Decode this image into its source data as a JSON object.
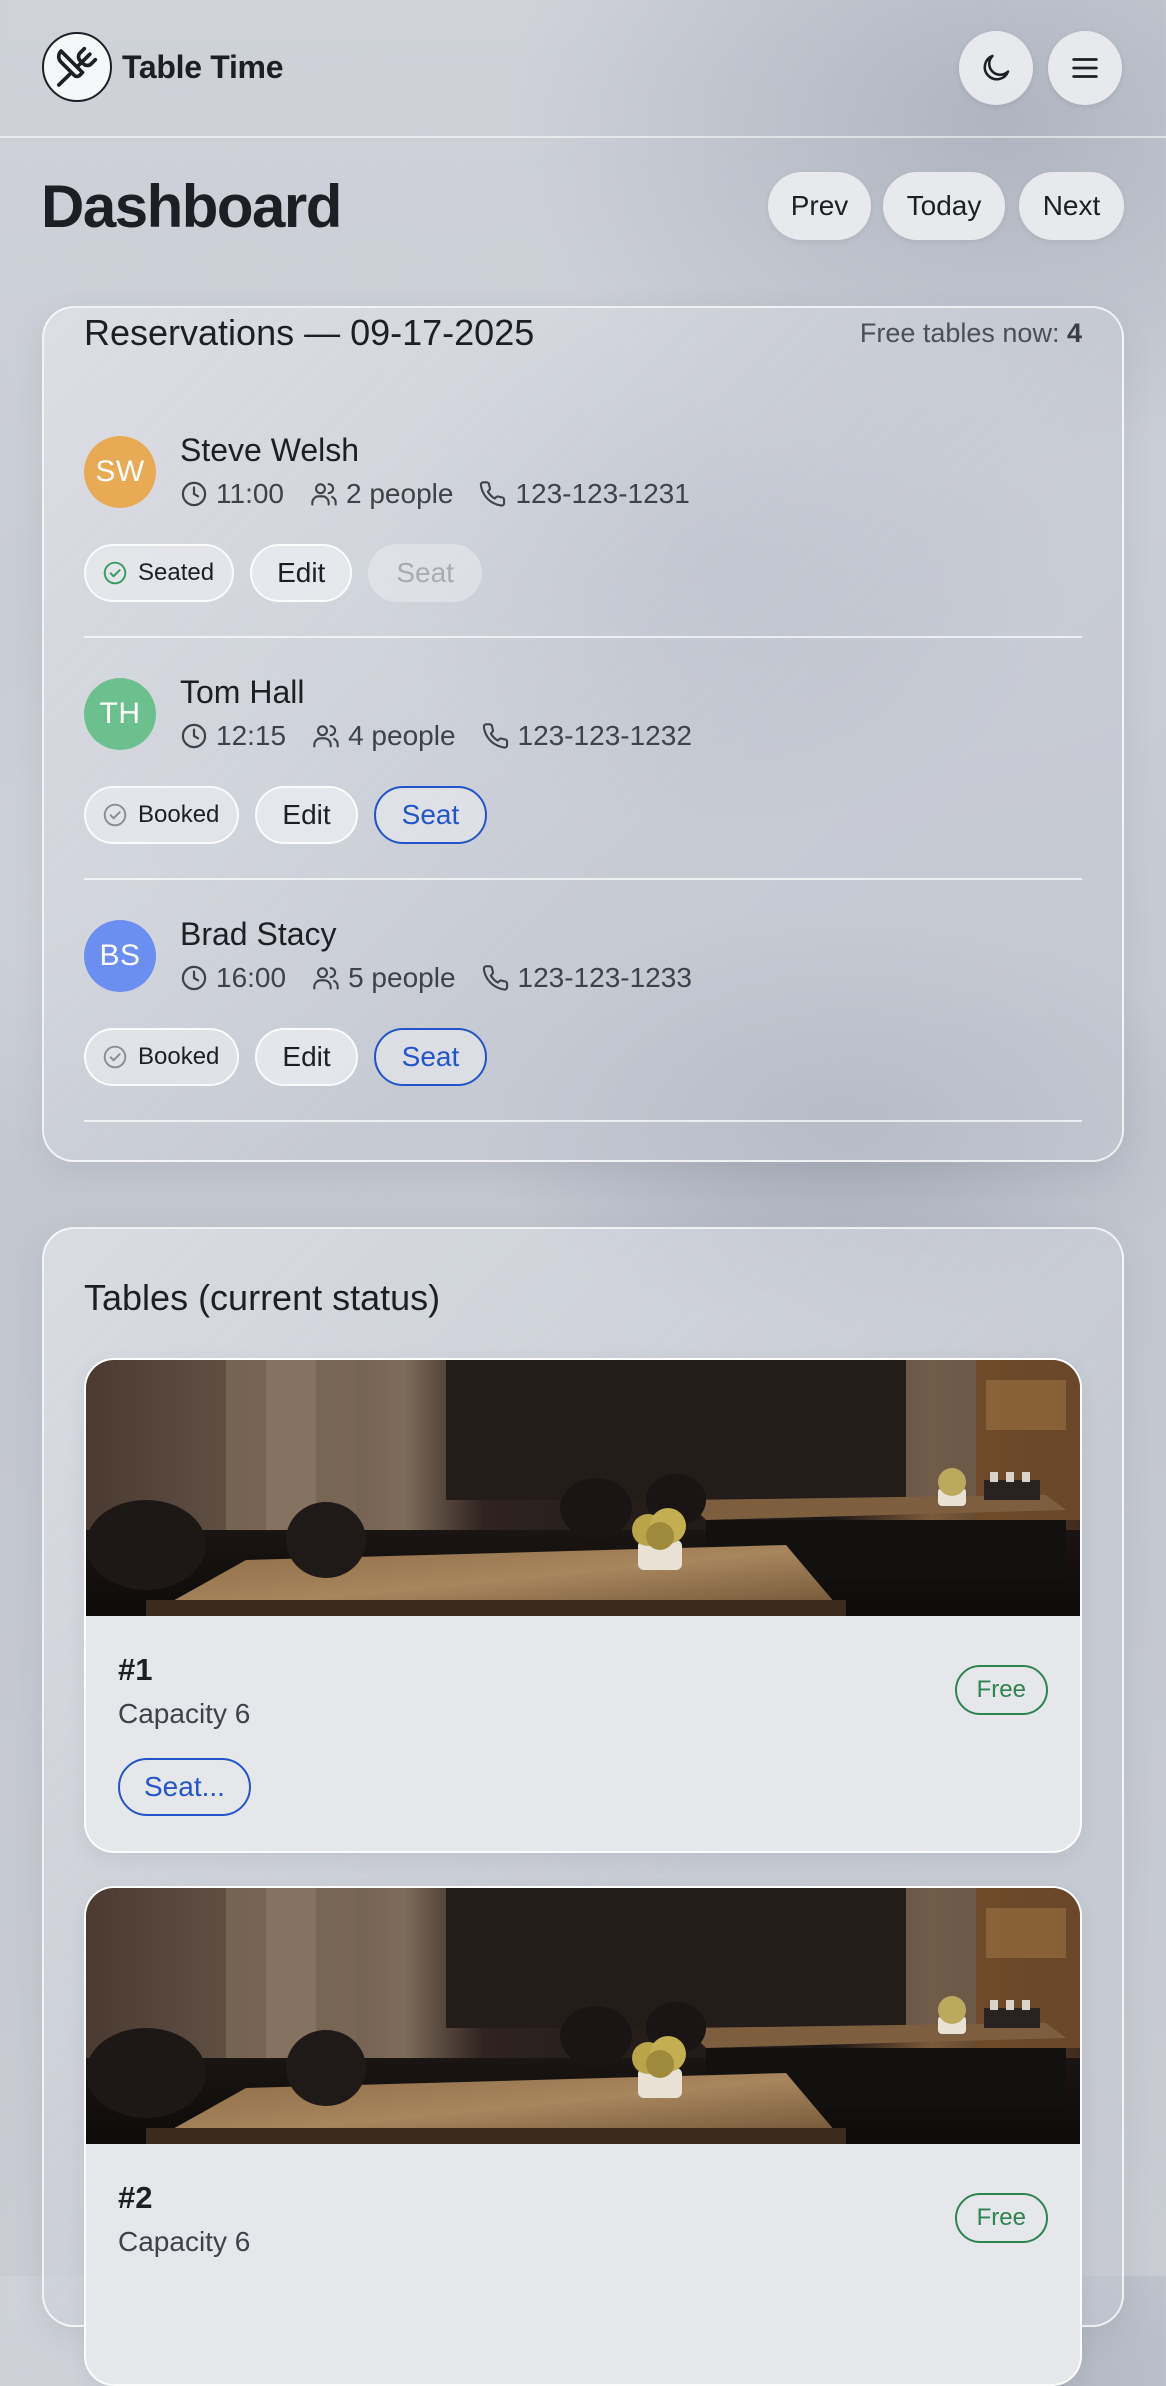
{
  "header": {
    "app_name": "Table Time",
    "logo_icon": "utensils-crossed-icon",
    "theme_icon": "moon-icon",
    "menu_icon": "hamburger-menu-icon"
  },
  "page": {
    "title": "Dashboard",
    "nav": {
      "prev": "Prev",
      "today": "Today",
      "next": "Next"
    }
  },
  "reservations": {
    "title": "Reservations — 09-17-2025",
    "free_tables_label": "Free tables now:",
    "free_tables_count": "4",
    "items": [
      {
        "initials": "SW",
        "avatar_color": "#e8aa55",
        "name": "Steve Welsh",
        "time": "11:00",
        "people": "2 people",
        "phone": "123-123-1231",
        "status": "Seated",
        "status_color": "#3a9a64",
        "edit_label": "Edit",
        "seat_label": "Seat",
        "seat_enabled": false
      },
      {
        "initials": "TH",
        "avatar_color": "#6cc08e",
        "name": "Tom Hall",
        "time": "12:15",
        "people": "4 people",
        "phone": "123-123-1232",
        "status": "Booked",
        "status_color": "#8a8d94",
        "edit_label": "Edit",
        "seat_label": "Seat",
        "seat_enabled": true
      },
      {
        "initials": "BS",
        "avatar_color": "#6b8ff0",
        "name": "Brad Stacy",
        "time": "16:00",
        "people": "5 people",
        "phone": "123-123-1233",
        "status": "Booked",
        "status_color": "#8a8d94",
        "edit_label": "Edit",
        "seat_label": "Seat",
        "seat_enabled": true
      }
    ]
  },
  "tables": {
    "title": "Tables (current status)",
    "items": [
      {
        "number": "#1",
        "capacity": "Capacity 6",
        "status": "Free",
        "action": "Seat..."
      },
      {
        "number": "#2",
        "capacity": "Capacity 6",
        "status": "Free"
      }
    ]
  },
  "colors": {
    "accent_blue": "#2454c9",
    "free_green": "#2f8350",
    "text_dark": "#1d1f24"
  }
}
